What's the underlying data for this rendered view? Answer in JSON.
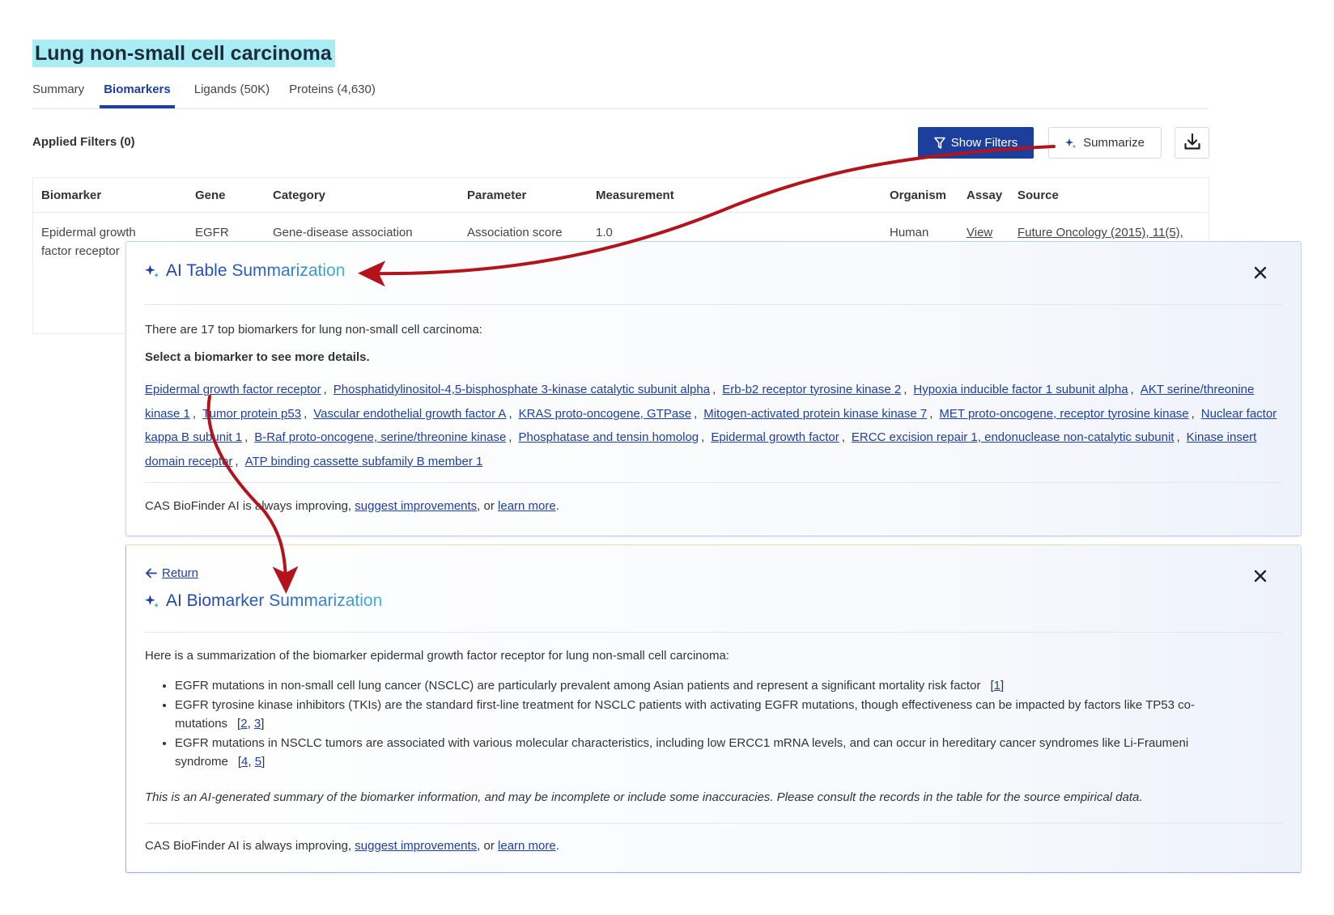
{
  "page": {
    "title": "Lung non-small cell carcinoma",
    "tabs": [
      {
        "label": "Summary",
        "active": false
      },
      {
        "label": "Biomarkers",
        "active": true
      },
      {
        "label": "Ligands (50K)",
        "active": false
      },
      {
        "label": "Proteins (4,630)",
        "active": false
      }
    ]
  },
  "toolbar": {
    "applied_filters": "Applied Filters (0)",
    "show_filters_label": "Show Filters",
    "summarize_label": "Summarize",
    "download_icon": "download-icon"
  },
  "table": {
    "columns": [
      "Biomarker",
      "Gene",
      "Category",
      "Parameter",
      "Measurement",
      "Organism",
      "Assay",
      "Source"
    ],
    "row": {
      "biomarker": "Epidermal growth factor receptor",
      "gene": "EGFR",
      "category": "Gene-disease association",
      "parameter": "Association score",
      "measurement": "1.0",
      "organism": "Human",
      "assay": "View",
      "source": "Future Oncology (2015), 11(5),"
    }
  },
  "table_summary": {
    "title": "AI Table Summarization",
    "intro": "There are 17 top biomarkers for lung non-small cell carcinoma:",
    "instruction": "Select a biomarker to see more details.",
    "biomarkers": [
      "Epidermal growth factor receptor",
      "Phosphatidylinositol-4,5-bisphosphate 3-kinase catalytic subunit alpha",
      "Erb-b2 receptor tyrosine kinase 2",
      "Hypoxia inducible factor 1 subunit alpha",
      "AKT serine/threonine kinase 1",
      "Tumor protein p53",
      "Vascular endothelial growth factor A",
      "KRAS proto-oncogene, GTPase",
      "Mitogen-activated protein kinase kinase 7",
      "MET proto-oncogene, receptor tyrosine kinase",
      "Nuclear factor kappa B subunit 1",
      "B-Raf proto-oncogene, serine/threonine kinase",
      "Phosphatase and tensin homolog",
      "Epidermal growth factor",
      "ERCC excision repair 1, endonuclease non-catalytic subunit",
      "Kinase insert domain receptor",
      "ATP binding cassette subfamily B member 1"
    ],
    "footer_prefix": "CAS BioFinder AI is always improving, ",
    "footer_link1": "suggest improvements",
    "footer_mid": ", or ",
    "footer_link2": "learn more",
    "footer_end": "."
  },
  "biomarker_summary": {
    "return_label": "Return",
    "title": "AI Biomarker Summarization",
    "intro": "Here is a summarization of the biomarker epidermal growth factor receptor for lung non-small cell carcinoma:",
    "bullets": [
      {
        "text": "EGFR mutations in non-small cell lung cancer (NSCLC) are particularly prevalent among Asian patients and represent a significant mortality risk factor",
        "refs": [
          "1"
        ]
      },
      {
        "text": "EGFR tyrosine kinase inhibitors (TKIs) are the standard first-line treatment for NSCLC patients with activating EGFR mutations, though effectiveness can be impacted by factors like TP53 co-mutations",
        "refs": [
          "2",
          "3"
        ]
      },
      {
        "text": "EGFR mutations in NSCLC tumors are associated with various molecular characteristics, including low ERCC1 mRNA levels, and can occur in hereditary cancer syndromes like Li-Fraumeni syndrome",
        "refs": [
          "4",
          "5"
        ]
      }
    ],
    "disclaimer": "This is an AI-generated summary of the biomarker information, and may be incomplete or include some inaccuracies. Please consult the records in the table for the source empirical data.",
    "footer_prefix": "CAS BioFinder AI is always improving, ",
    "footer_link1": "suggest improvements",
    "footer_mid": ", or ",
    "footer_link2": "learn more",
    "footer_end": "."
  },
  "colors": {
    "accent": "#1f3fa3",
    "title_highlight": "#a8ecf4",
    "arrow": "#b3141c"
  }
}
